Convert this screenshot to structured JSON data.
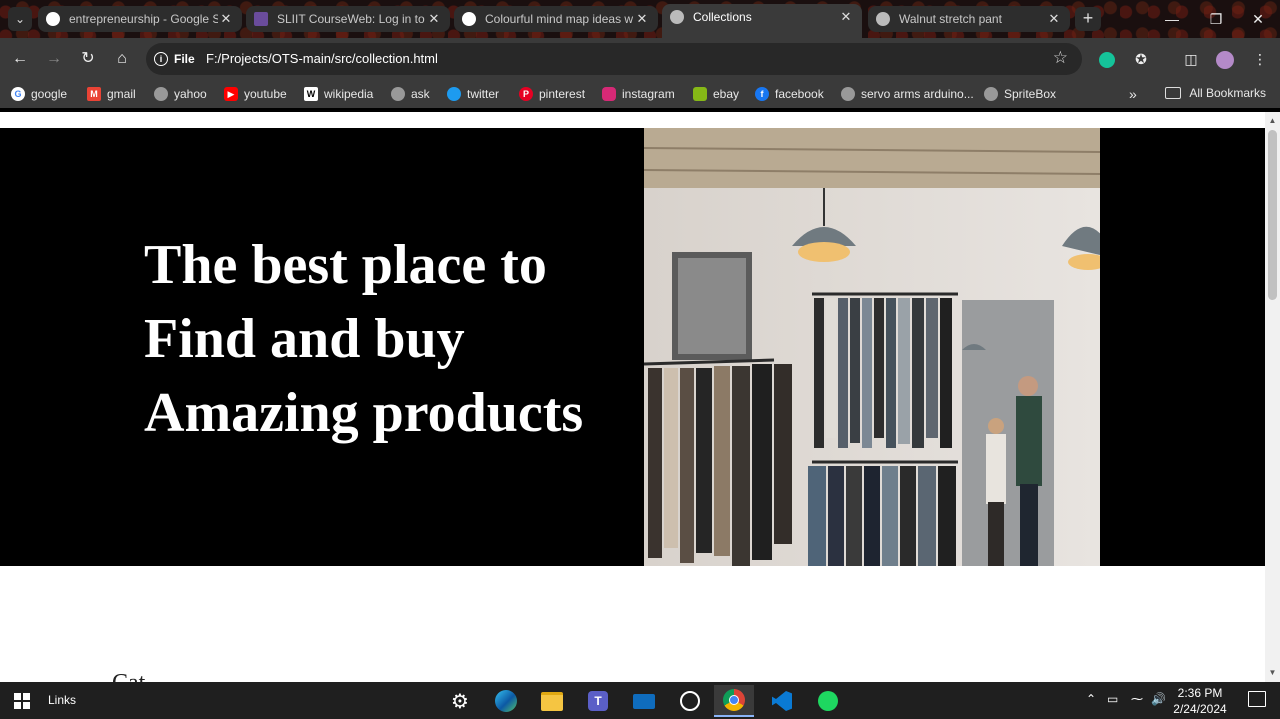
{
  "tabs": [
    {
      "title": "entrepreneurship - Google S",
      "favicon": "google-icon",
      "active": false
    },
    {
      "title": "SLIIT CourseWeb: Log in to t",
      "favicon": "sliit-icon",
      "active": false
    },
    {
      "title": "Colourful mind map ideas w",
      "favicon": "google-icon",
      "active": false
    },
    {
      "title": "Collections",
      "favicon": "globe-icon",
      "active": true
    },
    {
      "title": "Walnut stretch pant",
      "favicon": "globe-icon",
      "active": false
    }
  ],
  "address": {
    "chip": "File",
    "url": "F:/Projects/OTS-main/src/collection.html"
  },
  "bookmarks": [
    {
      "label": "google",
      "icon": "google-icon"
    },
    {
      "label": "gmail",
      "icon": "gmail-icon"
    },
    {
      "label": "yahoo",
      "icon": "globe-icon"
    },
    {
      "label": "youtube",
      "icon": "youtube-icon"
    },
    {
      "label": "wikipedia",
      "icon": "wikipedia-icon"
    },
    {
      "label": "ask",
      "icon": "globe-icon"
    },
    {
      "label": "twitter",
      "icon": "twitter-icon"
    },
    {
      "label": "pinterest",
      "icon": "pinterest-icon"
    },
    {
      "label": "instagram",
      "icon": "instagram-icon"
    },
    {
      "label": "ebay",
      "icon": "ebay-icon"
    },
    {
      "label": "facebook",
      "icon": "facebook-icon"
    },
    {
      "label": "servo arms arduino...",
      "icon": "globe-icon"
    },
    {
      "label": "SpriteBox",
      "icon": "globe-icon"
    }
  ],
  "all_bookmarks": "All Bookmarks",
  "overflow_chevron": "»",
  "hero": {
    "line1": "The best place to",
    "line2": "Find and buy",
    "line3": "Amazing products"
  },
  "subhead_partial": "Cat",
  "taskbar": {
    "links_label": "Links",
    "time": "2:36 PM",
    "date": "2/24/2024"
  },
  "colors": {
    "tab_bg": "#2d2d2d",
    "toolbar_bg": "#3a3a3a",
    "hero_bg": "#000000",
    "hero_text": "#ffffff",
    "taskbar_bg": "#1f1f1f"
  }
}
